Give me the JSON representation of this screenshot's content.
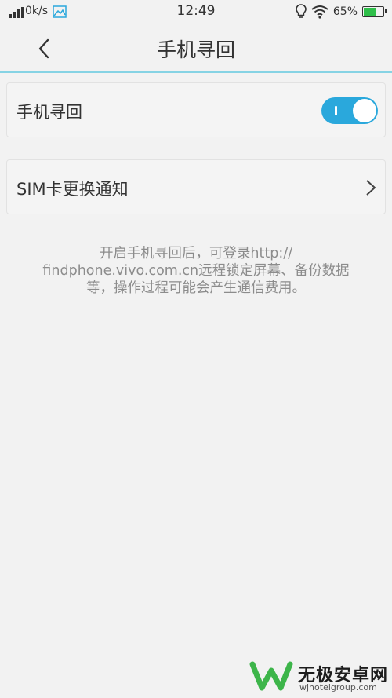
{
  "status_bar": {
    "net_speed": "0k/s",
    "time": "12:49",
    "battery": "65%",
    "battery_level": 0.65,
    "icons": [
      "signal-icon",
      "gallery-icon",
      "bulb-icon",
      "wifi-icon",
      "battery-icon"
    ]
  },
  "header": {
    "title": "手机寻回",
    "back_icon": "back-arrow-icon"
  },
  "settings": {
    "find_phone": {
      "label": "手机寻回",
      "toggle_on": true
    },
    "sim_notify": {
      "label": "SIM卡更换通知"
    }
  },
  "description": {
    "lines": [
      "开启手机寻回后，可登录http://",
      "findphone.vivo.com.cn远程锁定屏幕、备份数据",
      "等，操作过程可能会产生通信费用。"
    ]
  },
  "watermark": {
    "name": "无极安卓网",
    "url": "wjhotelgroup.com"
  },
  "colors": {
    "accent": "#2aa8dc",
    "header_line": "#86d3e4",
    "background": "#f2f2f2",
    "battery_fill": "#2fbf4a",
    "logo_green": "#3db54a"
  }
}
